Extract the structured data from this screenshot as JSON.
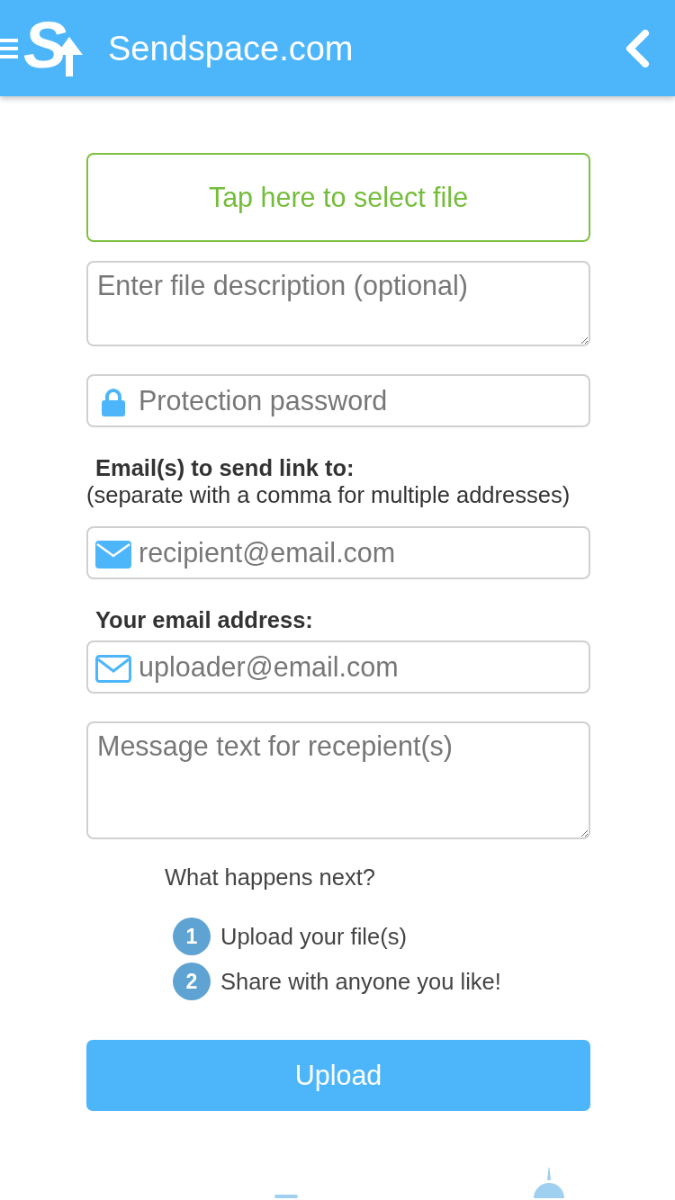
{
  "header": {
    "logo_letter": "S",
    "title": "Sendspace.com"
  },
  "form": [
    {
      "kind": "file_button",
      "label": "Tap here to select file"
    },
    {
      "kind": "short_textarea",
      "placeholder": "Enter file description (optional)"
    },
    {
      "kind": "password_input",
      "placeholder": "Protection password"
    },
    {
      "kind": "label",
      "text": "Email(s) to send link to:",
      "note": "(separate with a comma for multiple addresses)"
    },
    {
      "kind": "recipient_input",
      "placeholder": "recipient@email.com"
    },
    {
      "kind": "label",
      "text": "Your email address:"
    },
    {
      "kind": "sender_input",
      "placeholder": "uploader@email.com"
    },
    {
      "kind": "tall_textarea",
      "placeholder": "Message text for recepient(s)"
    }
  ],
  "next_steps": {
    "title": "What happens next?",
    "steps": [
      {
        "number": "1",
        "text": "Upload your file(s)"
      },
      {
        "number": "2",
        "text": "Share with anyone you like!"
      }
    ]
  },
  "upload_button": {
    "label": "Upload"
  }
}
